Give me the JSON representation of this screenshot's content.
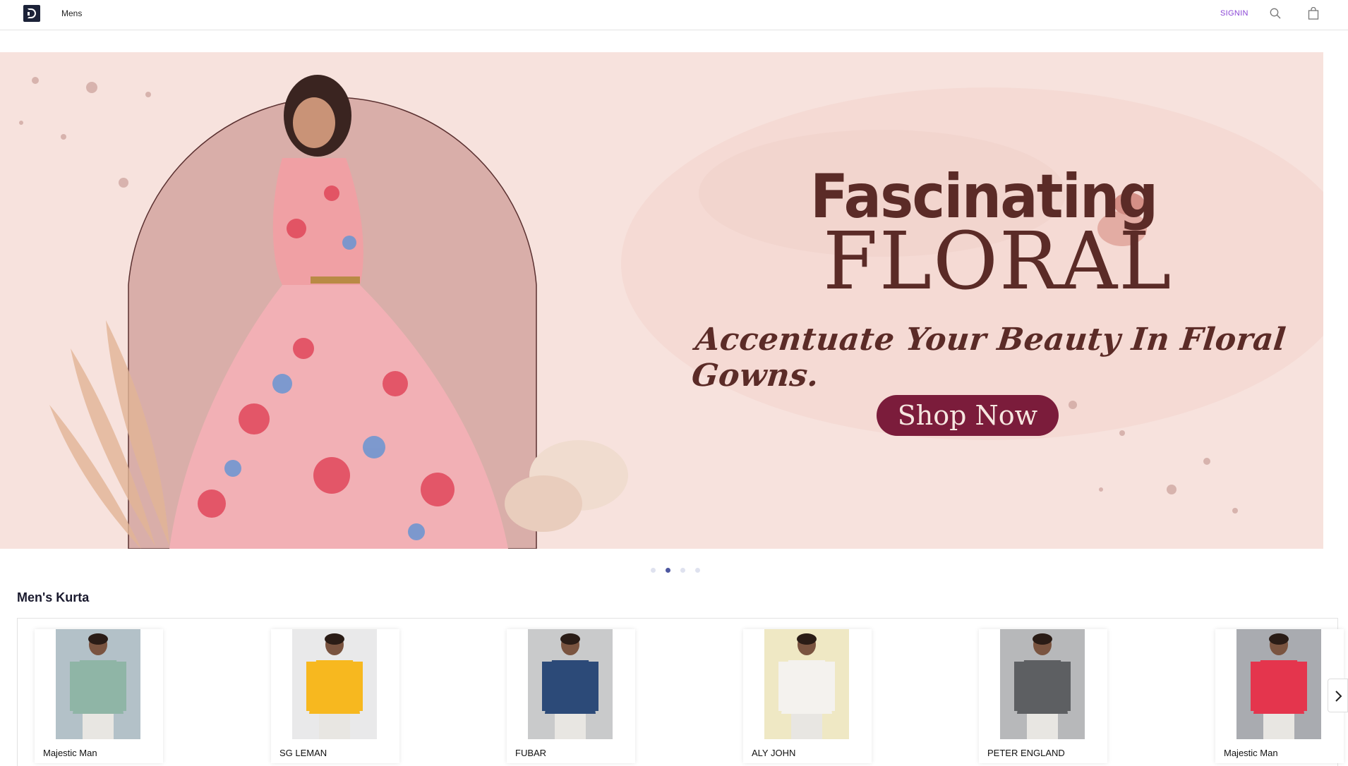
{
  "header": {
    "nav_label": "Mens",
    "signin_label": "SIGNIN",
    "icons": [
      "logo-icon",
      "search-icon",
      "bag-icon"
    ]
  },
  "banner": {
    "headline_1": "Fascinating",
    "headline_2": "FLORAL",
    "tagline": "Accentuate Your Beauty In Floral Gowns.",
    "cta_label": "Shop Now",
    "slide_count": 4,
    "active_slide": 2
  },
  "section": {
    "title": "Men's Kurta",
    "products": [
      {
        "name": "Majestic Man",
        "image_bg": "#b3c1c8",
        "shirt": "#8fb5a6"
      },
      {
        "name": "SG LEMAN",
        "image_bg": "#e9e9ea",
        "shirt": "#f7b81f"
      },
      {
        "name": "FUBAR",
        "image_bg": "#c9cacb",
        "shirt": "#2c4a78"
      },
      {
        "name": "ALY JOHN",
        "image_bg": "#efe8c4",
        "shirt": "#f4f2ee"
      },
      {
        "name": "PETER ENGLAND",
        "image_bg": "#b7b8ba",
        "shirt": "#5d5f62"
      },
      {
        "name": "Majestic Man",
        "image_bg": "#a9abb0",
        "shirt": "#e4354d"
      }
    ]
  },
  "colors": {
    "accent_signin": "#8a45d6",
    "banner_bg": "#f7e2dd",
    "headline": "#5b2b27",
    "cta_bg": "#7b1c3b",
    "dot_active": "#4d57a0"
  }
}
